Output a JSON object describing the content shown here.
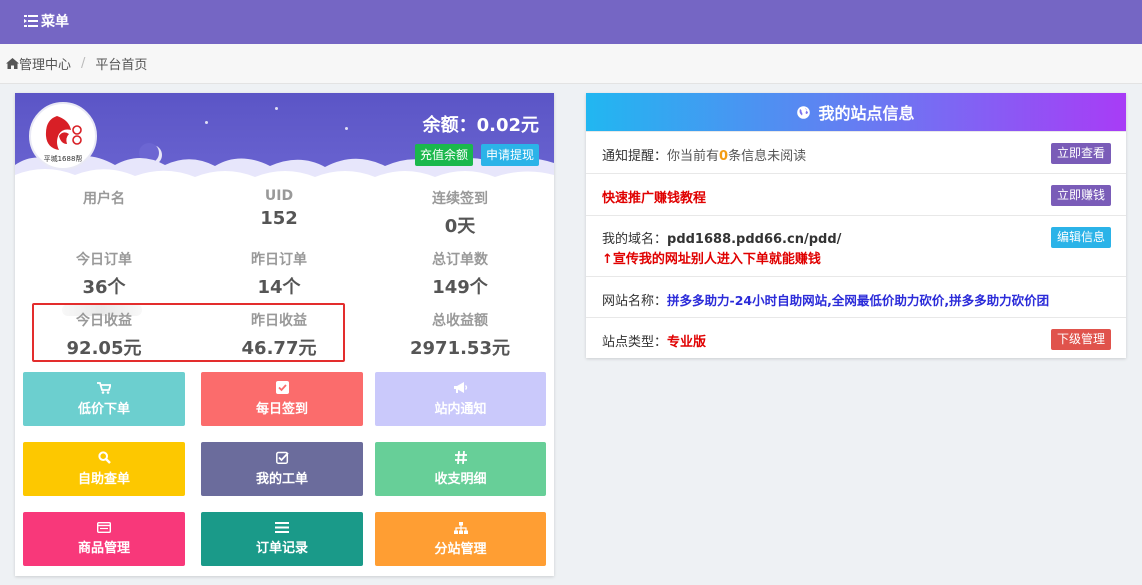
{
  "nav": {
    "menu_label": "菜单"
  },
  "breadcrumb": {
    "home": "管理中心",
    "current": "平台首页"
  },
  "user_card": {
    "logo_text": "平城1688帮",
    "balance": "余额：0.02元",
    "recharge_button": "充值余额",
    "withdraw_button": "申请提现",
    "stats": [
      {
        "label": "用户名",
        "value": ""
      },
      {
        "label": "UID",
        "value": "152"
      },
      {
        "label": "连续签到",
        "value": "0天"
      },
      {
        "label": "今日订单",
        "value": "36个"
      },
      {
        "label": "昨日订单",
        "value": "14个"
      },
      {
        "label": "总订单数",
        "value": "149个"
      },
      {
        "label": "今日收益",
        "value": "92.05元"
      },
      {
        "label": "昨日收益",
        "value": "46.77元"
      },
      {
        "label": "总收益额",
        "value": "2971.53元"
      }
    ]
  },
  "tiles": [
    {
      "label": "低价下单",
      "icon": "cart-icon",
      "color": "#6ccfcf"
    },
    {
      "label": "每日签到",
      "icon": "check-square-icon",
      "color": "#fb6c6c"
    },
    {
      "label": "站内通知",
      "icon": "megaphone-icon",
      "color": "#cac9fb"
    },
    {
      "label": "自助查单",
      "icon": "search-icon",
      "color": "#fdc800"
    },
    {
      "label": "我的工单",
      "icon": "edit-check-icon",
      "color": "#6b6c9c"
    },
    {
      "label": "收支明细",
      "icon": "hashtag-icon",
      "color": "#67cf98"
    },
    {
      "label": "商品管理",
      "icon": "card-icon",
      "color": "#f8387a"
    },
    {
      "label": "订单记录",
      "icon": "list-icon",
      "color": "#1a9a89"
    },
    {
      "label": "分站管理",
      "icon": "sitemap-icon",
      "color": "#ff9e33"
    }
  ],
  "site_info": {
    "title": "我的站点信息",
    "notice_label": "通知提醒：",
    "notice_prefix": "你当前有",
    "notice_count": "0",
    "notice_suffix": "条信息未阅读",
    "notice_button": "立即查看",
    "promo_text": "快速推广赚钱教程",
    "promo_button": "立即赚钱",
    "domain_label": "我的域名：",
    "domain_value": "pdd1688.pdd66.cn/pdd/",
    "domain_tip": "↑宣传我的网址别人进入下单就能赚钱",
    "domain_button": "编辑信息",
    "site_name_label": "网站名称：",
    "site_name_value": "拼多多助力-24小时自助网站,全网最低价助力砍价,拼多多助力砍价团",
    "site_type_label": "站点类型：",
    "site_type_value": "专业版",
    "site_type_button": "下级管理"
  },
  "colors": {
    "topbar": "#7566c4",
    "recharge": "#1ab84c",
    "withdraw": "#2bb3e8",
    "purple_button": "#7a5cb8",
    "cyan_button": "#2bb3e8",
    "red_button": "#e0534c",
    "link_blue": "#2b2bd9",
    "red_text": "#e00000"
  }
}
